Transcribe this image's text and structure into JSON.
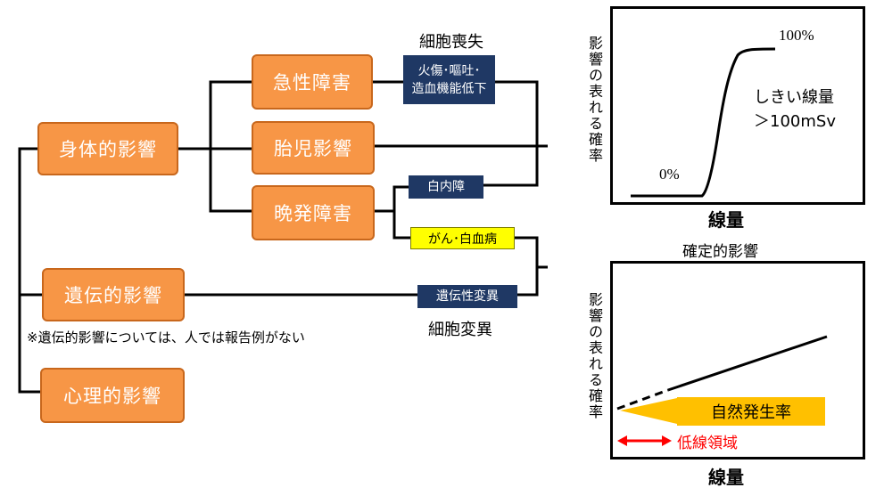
{
  "diagram": {
    "nodes": {
      "physical": "身体的影響",
      "genetic": "遺伝的影響",
      "psychological": "心理的影響",
      "acute": "急性障害",
      "fetal": "胎児影響",
      "late": "晩発障害"
    },
    "tags": {
      "acute_effects_line1": "火傷･嘔吐･",
      "acute_effects_line2": "造血機能低下",
      "cataract": "白内障",
      "cancer": "がん･白血病",
      "genetic_mutation": "遺伝性変異"
    },
    "labels": {
      "cell_death": "細胞喪失",
      "cell_mutation": "細胞変異",
      "note": "※遺伝的影響については、人では報告例がない"
    }
  },
  "chart_data": [
    {
      "type": "line",
      "title": "",
      "xlabel": "線量",
      "ylabel": "影響の表れる確率",
      "annotations": {
        "top": "100%",
        "bottom": "0%",
        "threshold_line1": "しきい線量",
        "threshold_line2": "＞100mSv"
      }
    },
    {
      "type": "line",
      "title": "確定的影響",
      "xlabel": "線量",
      "ylabel": "影響の表れる確率",
      "annotations": {
        "natural_rate": "自然発生率",
        "low_dose": "低線領域"
      },
      "colors": {
        "natural_rate_box": "#ffc000",
        "low_dose_arrow": "#ff0000"
      }
    }
  ]
}
